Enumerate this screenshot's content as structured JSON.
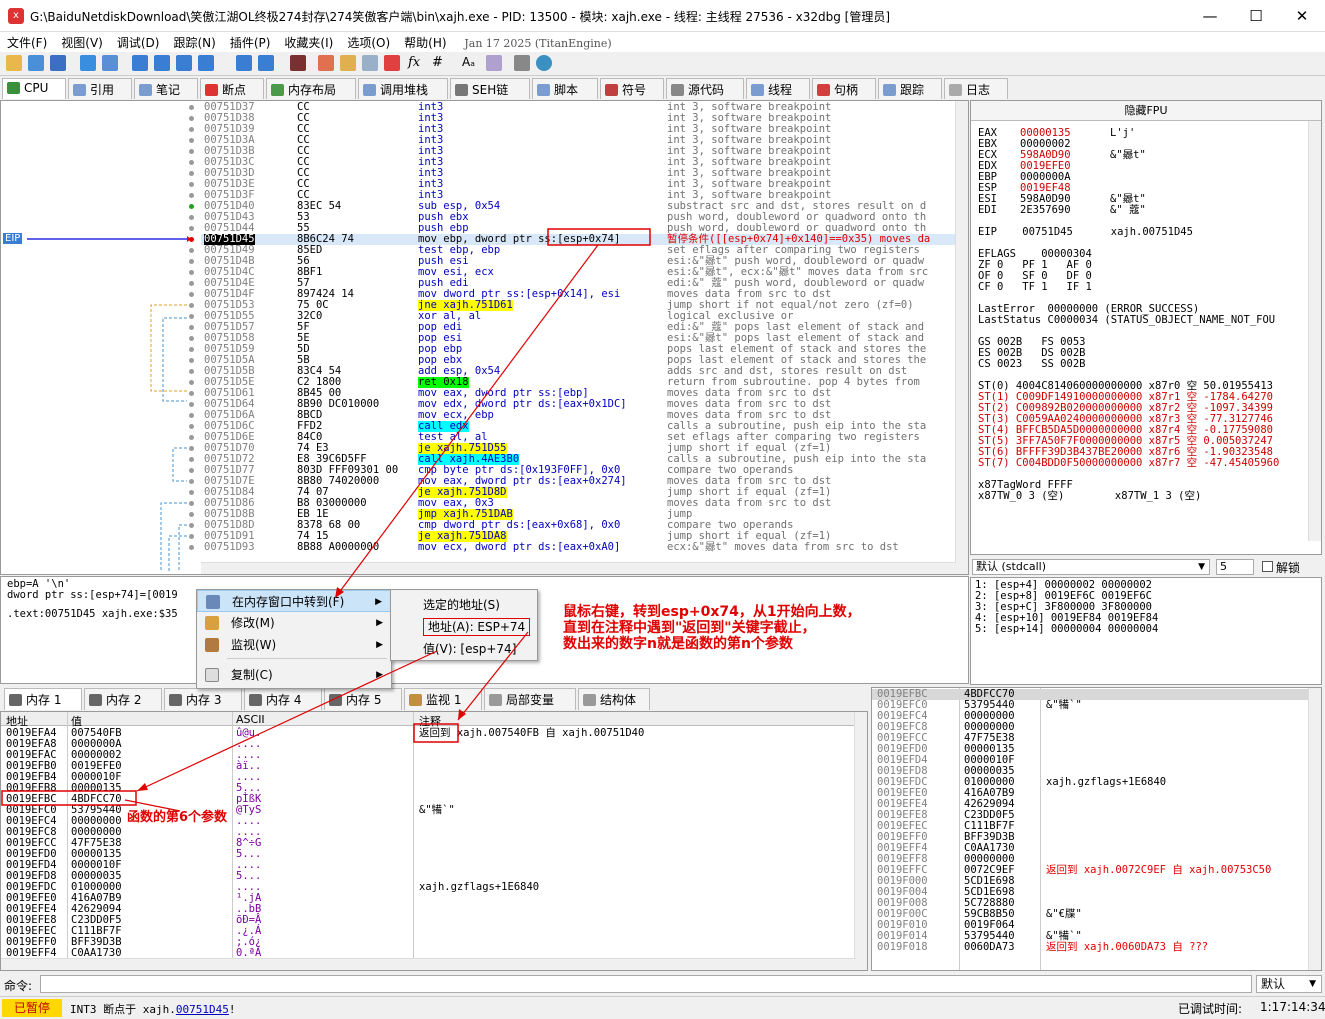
{
  "window": {
    "title": "G:\\BaiduNetdiskDownload\\笑傲江湖OL终极274封存\\274笑傲客户端\\bin\\xajh.exe - PID: 13500 - 模块: xajh.exe - 线程: 主线程 27536 - x32dbg [管理员]",
    "minimize": "—",
    "maximize": "☐",
    "close": "✕"
  },
  "menu": {
    "items": [
      "文件(F)",
      "视图(V)",
      "调试(D)",
      "跟踪(N)",
      "插件(P)",
      "收藏夹(I)",
      "选项(O)",
      "帮助(H)"
    ],
    "build": "Jan 17 2025 (TitanEngine)"
  },
  "tabs": [
    "CPU",
    "引用",
    "笔记",
    "断点",
    "内存布局",
    "调用堆栈",
    "SEH链",
    "脚本",
    "符号",
    "源代码",
    "线程",
    "句柄",
    "跟踪",
    "日志"
  ],
  "disasm": {
    "eip_label": "EIP",
    "rows": [
      {
        "a": "00751D37",
        "b": "CC",
        "i": "int3",
        "c": "int 3, software breakpoint"
      },
      {
        "a": "00751D38",
        "b": "CC",
        "i": "int3",
        "c": "int 3, software breakpoint"
      },
      {
        "a": "00751D39",
        "b": "CC",
        "i": "int3",
        "c": "int 3, software breakpoint"
      },
      {
        "a": "00751D3A",
        "b": "CC",
        "i": "int3",
        "c": "int 3, software breakpoint"
      },
      {
        "a": "00751D3B",
        "b": "CC",
        "i": "int3",
        "c": "int 3, software breakpoint"
      },
      {
        "a": "00751D3C",
        "b": "CC",
        "i": "int3",
        "c": "int 3, software breakpoint"
      },
      {
        "a": "00751D3D",
        "b": "CC",
        "i": "int3",
        "c": "int 3, software breakpoint"
      },
      {
        "a": "00751D3E",
        "b": "CC",
        "i": "int3",
        "c": "int 3, software breakpoint"
      },
      {
        "a": "00751D3F",
        "b": "CC",
        "i": "int3",
        "c": "int 3, software breakpoint"
      },
      {
        "a": "00751D40",
        "b": "83EC 54",
        "i": "sub esp, 0x54",
        "c": "substract src and dst, stores result on d"
      },
      {
        "a": "00751D43",
        "b": "53",
        "i": "push ebx",
        "c": "push word, doubleword or quadword onto th"
      },
      {
        "a": "00751D44",
        "b": "55",
        "i": "push ebp",
        "c": "push word, doubleword or quadword onto th"
      },
      {
        "a": "00751D45",
        "b": "8B6C24 74",
        "i": "mov ebp, dword ptr ss:[esp+0x74]",
        "c": "暂停条件([[esp+0x74]+0x140]==0x35) moves da"
      },
      {
        "a": "00751D49",
        "b": "85ED",
        "i": "test ebp, ebp",
        "c": "set eflags after comparing two registers"
      },
      {
        "a": "00751D4B",
        "b": "56",
        "i": "push esi",
        "c": "esi:&\"曏t\" push word, doubleword or quadw"
      },
      {
        "a": "00751D4C",
        "b": "8BF1",
        "i": "mov esi, ecx",
        "c": "esi:&\"曏t\", ecx:&\"曏t\" moves data from src"
      },
      {
        "a": "00751D4E",
        "b": "57",
        "i": "push edi",
        "c": "edi:&\" 蔻\" push word, doubleword or quadw"
      },
      {
        "a": "00751D4F",
        "b": "897424 14",
        "i": "mov dword ptr ss:[esp+0x14], esi",
        "c": "moves data from src to dst"
      },
      {
        "a": "00751D53",
        "b": "75 0C",
        "i": "jne xajh.751D61",
        "c": "jump short if not equal/not zero (zf=0)"
      },
      {
        "a": "00751D55",
        "b": "32C0",
        "i": "xor al, al",
        "c": "logical exclusive or"
      },
      {
        "a": "00751D57",
        "b": "5F",
        "i": "pop edi",
        "c": "edi:&\" 蔻\" pops last element of stack and"
      },
      {
        "a": "00751D58",
        "b": "5E",
        "i": "pop esi",
        "c": "esi:&\"曏t\" pops last element of stack and"
      },
      {
        "a": "00751D59",
        "b": "5D",
        "i": "pop ebp",
        "c": "pops last element of stack and stores the"
      },
      {
        "a": "00751D5A",
        "b": "5B",
        "i": "pop ebx",
        "c": "pops last element of stack and stores the"
      },
      {
        "a": "00751D5B",
        "b": "83C4 54",
        "i": "add esp, 0x54",
        "c": "adds src and dst, stores result on dst"
      },
      {
        "a": "00751D5E",
        "b": "C2 1800",
        "i": "ret 0x18",
        "c": "return from subroutine. pop 4 bytes from"
      },
      {
        "a": "00751D61",
        "b": "8B45 00",
        "i": "mov eax, dword ptr ss:[ebp]",
        "c": "moves data from src to dst"
      },
      {
        "a": "00751D64",
        "b": "8B90 DC010000",
        "i": "mov edx, dword ptr ds:[eax+0x1DC]",
        "c": "moves data from src to dst"
      },
      {
        "a": "00751D6A",
        "b": "8BCD",
        "i": "mov ecx, ebp",
        "c": "moves data from src to dst"
      },
      {
        "a": "00751D6C",
        "b": "FFD2",
        "i": "call edx",
        "c": "calls a subroutine, push eip into the sta"
      },
      {
        "a": "00751D6E",
        "b": "84C0",
        "i": "test al, al",
        "c": "set eflags after comparing two registers"
      },
      {
        "a": "00751D70",
        "b": "74 E3",
        "i": "je xajh.751D55",
        "c": "jump short if equal (zf=1)"
      },
      {
        "a": "00751D72",
        "b": "E8 39C6D5FF",
        "i": "call xajh.4AE3B0",
        "c": "calls a subroutine, push eip into the sta"
      },
      {
        "a": "00751D77",
        "b": "803D FFF09301 00",
        "i": "cmp byte ptr ds:[0x193F0FF], 0x0",
        "c": "compare two operands"
      },
      {
        "a": "00751D7E",
        "b": "8B80 74020000",
        "i": "mov eax, dword ptr ds:[eax+0x274]",
        "c": "moves data from src to dst"
      },
      {
        "a": "00751D84",
        "b": "74 07",
        "i": "je xajh.751D8D",
        "c": "jump short if equal (zf=1)"
      },
      {
        "a": "00751D86",
        "b": "B8 03000000",
        "i": "mov eax, 0x3",
        "c": "moves data from src to dst"
      },
      {
        "a": "00751D8B",
        "b": "EB 1E",
        "i": "jmp xajh.751DAB",
        "c": "jump"
      },
      {
        "a": "00751D8D",
        "b": "8378 68 00",
        "i": "cmp dword ptr ds:[eax+0x68], 0x0",
        "c": "compare two operands"
      },
      {
        "a": "00751D91",
        "b": "74 15",
        "i": "je xajh.751DA8",
        "c": "jump short if equal (zf=1)"
      },
      {
        "a": "00751D93",
        "b": "8B88 A0000000",
        "i": "mov ecx, dword ptr ds:[eax+0xA0]",
        "c": "ecx:&\"曏t\" moves data from src to dst"
      }
    ]
  },
  "regs": {
    "header": "隐藏FPU",
    "lines": [
      {
        "n": "EAX",
        "v": "00000135",
        "x": "L'j'",
        "r": true
      },
      {
        "n": "EBX",
        "v": "00000002",
        "x": "",
        "r": false
      },
      {
        "n": "ECX",
        "v": "598A0D90",
        "x": "&\"曏t\"",
        "r": true
      },
      {
        "n": "EDX",
        "v": "0019EFE0",
        "x": "",
        "r": true
      },
      {
        "n": "EBP",
        "v": "0000000A",
        "x": "",
        "r": false
      },
      {
        "n": "ESP",
        "v": "0019EF48",
        "x": "",
        "r": true
      },
      {
        "n": "ESI",
        "v": "598A0D90",
        "x": "&\"曏t\"",
        "r": false
      },
      {
        "n": "EDI",
        "v": "2E357690",
        "x": "&\" 蔻\"",
        "r": false
      }
    ],
    "eip": "EIP    00751D45      xajh.00751D45",
    "eflags": "EFLAGS    00000304",
    "flags": [
      "ZF 0   PF 1   AF 0",
      "OF 0   SF 0   DF 0",
      "CF 0   TF 1   IF 1"
    ],
    "lasterror": "LastError  00000000 (ERROR_SUCCESS)",
    "laststatus": "LastStatus C0000034 (STATUS_OBJECT_NAME_NOT_FOU",
    "segs": [
      "GS 002B   FS 0053",
      "ES 002B   DS 002B",
      "CS 0023   SS 002B"
    ],
    "fpu": [
      "ST(0) 4004C814060000000000 x87r0 空 50.01955413",
      "ST(1) C009DF14910000000000 x87r1 空 -1784.64270",
      "ST(2) C009892B020000000000 x87r2 空 -1097.34399",
      "ST(3) C0059AA0240000000000 x87r3 空 -77.3127746",
      "ST(4) BFFCB5DA5D0000000000 x87r4 空 -0.17759080",
      "ST(5) 3FF7A50F7F0000000000 x87r5 空 0.005037247",
      "ST(6) BFFFF39D3B437BE20000 x87r6 空 -1.90323548",
      "ST(7) C004BDD0F50000000000 x87r7 空 -47.45405960"
    ],
    "tagword": "x87TagWord FFFF",
    "tw": "x87TW_0 3 (空)        x87TW_1 3 (空)"
  },
  "callconv": {
    "select": "默认 (stdcall)",
    "count": "5",
    "unlock": "解锁"
  },
  "args": [
    "1: [esp+4]  00000002 00000002",
    "2: [esp+8]  0019EF6C 0019EF6C",
    "3: [esp+C]  3F800000 3F800000",
    "4: [esp+10] 0019EF84 0019EF84",
    "5: [esp+14] 00000004 00000004"
  ],
  "info": {
    "l1": "ebp=A '\\n'",
    "l2": "dword ptr ss:[esp+74]=[0019",
    "l3": ".text:00751D45 xajh.exe:$35"
  },
  "ctxmenu": {
    "items": [
      "在内存窗口中转到(F)",
      "修改(M)",
      "监视(W)",
      "复制(C)"
    ]
  },
  "submenu": {
    "items": [
      "选定的地址(S)",
      "地址(A): ESP+74",
      "值(V):  [esp+74]"
    ]
  },
  "annotations": {
    "note": "鼠标右键，转到esp+0x74，从1开始向上数，\n直到在注释中遇到\"返回到\"关键字截止，\n数出来的数字n就是函数的第n个参数",
    "param": "函数的第6个参数"
  },
  "btabs": [
    "内存 1",
    "内存 2",
    "内存 3",
    "内存 4",
    "内存 5",
    "监视 1",
    "局部变量",
    "结构体"
  ],
  "dump": {
    "headers": [
      "地址",
      "值",
      "ASCII",
      "注释"
    ],
    "rows": [
      {
        "a": "0019EFA4",
        "v": "007540FB",
        "s": "û@u.",
        "c": "返回到 xajh.007540FB 自 xajh.00751D40"
      },
      {
        "a": "0019EFA8",
        "v": "0000000A",
        "s": "....",
        "c": ""
      },
      {
        "a": "0019EFAC",
        "v": "00000002",
        "s": "....",
        "c": ""
      },
      {
        "a": "0019EFB0",
        "v": "0019EFE0",
        "s": "àï..",
        "c": ""
      },
      {
        "a": "0019EFB4",
        "v": "0000010F",
        "s": "....",
        "c": ""
      },
      {
        "a": "0019EFB8",
        "v": "00000135",
        "s": "5...",
        "c": ""
      },
      {
        "a": "0019EFBC",
        "v": "4BDFCC70",
        "s": "pÌßK",
        "c": ""
      },
      {
        "a": "0019EFC0",
        "v": "53795440",
        "s": "@TyS",
        "c": "&\"犕`\""
      },
      {
        "a": "0019EFC4",
        "v": "00000000",
        "s": "....",
        "c": ""
      },
      {
        "a": "0019EFC8",
        "v": "00000000",
        "s": "....",
        "c": ""
      },
      {
        "a": "0019EFCC",
        "v": "47F75E38",
        "s": "8^÷G",
        "c": ""
      },
      {
        "a": "0019EFD0",
        "v": "00000135",
        "s": "5...",
        "c": ""
      },
      {
        "a": "0019EFD4",
        "v": "0000010F",
        "s": "....",
        "c": ""
      },
      {
        "a": "0019EFD8",
        "v": "00000035",
        "s": "5...",
        "c": ""
      },
      {
        "a": "0019EFDC",
        "v": "01000000",
        "s": "....",
        "c": "xajh.gzflags+1E6840"
      },
      {
        "a": "0019EFE0",
        "v": "416A07B9",
        "s": "¹.jA",
        "c": ""
      },
      {
        "a": "0019EFE4",
        "v": "42629094",
        "s": "..bB",
        "c": ""
      },
      {
        "a": "0019EFE8",
        "v": "C23DD0F5",
        "s": "õÐ=Â",
        "c": ""
      },
      {
        "a": "0019EFEC",
        "v": "C111BF7F",
        "s": ".¿.Á",
        "c": ""
      },
      {
        "a": "0019EFF0",
        "v": "BFF39D3B",
        "s": ";.ó¿",
        "c": ""
      },
      {
        "a": "0019EFF4",
        "v": "C0AA1730",
        "s": "0.ªÀ",
        "c": ""
      }
    ]
  },
  "stack": {
    "rows": [
      {
        "a": "0019EFBC",
        "v": "4BDFCC70",
        "c": ""
      },
      {
        "a": "0019EFC0",
        "v": "53795440",
        "c": "&\"犕`\""
      },
      {
        "a": "0019EFC4",
        "v": "00000000",
        "c": ""
      },
      {
        "a": "0019EFC8",
        "v": "00000000",
        "c": ""
      },
      {
        "a": "0019EFCC",
        "v": "47F75E38",
        "c": ""
      },
      {
        "a": "0019EFD0",
        "v": "00000135",
        "c": ""
      },
      {
        "a": "0019EFD4",
        "v": "0000010F",
        "c": ""
      },
      {
        "a": "0019EFD8",
        "v": "00000035",
        "c": ""
      },
      {
        "a": "0019EFDC",
        "v": "01000000",
        "c": "xajh.gzflags+1E6840"
      },
      {
        "a": "0019EFE0",
        "v": "416A07B9",
        "c": ""
      },
      {
        "a": "0019EFE4",
        "v": "42629094",
        "c": ""
      },
      {
        "a": "0019EFE8",
        "v": "C23DD0F5",
        "c": ""
      },
      {
        "a": "0019EFEC",
        "v": "C111BF7F",
        "c": ""
      },
      {
        "a": "0019EFF0",
        "v": "BFF39D3B",
        "c": ""
      },
      {
        "a": "0019EFF4",
        "v": "C0AA1730",
        "c": ""
      },
      {
        "a": "0019EFF8",
        "v": "00000000",
        "c": ""
      },
      {
        "a": "0019EFFC",
        "v": "0072C9EF",
        "c": "返回到 xajh.0072C9EF 自 xajh.00753C50"
      },
      {
        "a": "0019F000",
        "v": "5CD1E698",
        "c": ""
      },
      {
        "a": "0019F004",
        "v": "5CD1E698",
        "c": ""
      },
      {
        "a": "0019F008",
        "v": "5C728880",
        "c": ""
      },
      {
        "a": "0019F00C",
        "v": "59CB8B50",
        "c": "&\"€牒\""
      },
      {
        "a": "0019F010",
        "v": "0019F064",
        "c": ""
      },
      {
        "a": "0019F014",
        "v": "53795440",
        "c": "&\"犕`\""
      },
      {
        "a": "0019F018",
        "v": "0060DA73",
        "c": "返回到 xajh.0060DA73 自 ???"
      }
    ]
  },
  "cmd": {
    "label": "命令:",
    "select": "默认"
  },
  "status": {
    "state": "已暂停",
    "msg": "INT3 断点于 xajh.",
    "addr": "00751D45",
    "tail": "!",
    "time_label": "已调试时间:",
    "time": "1:17:14:34"
  }
}
